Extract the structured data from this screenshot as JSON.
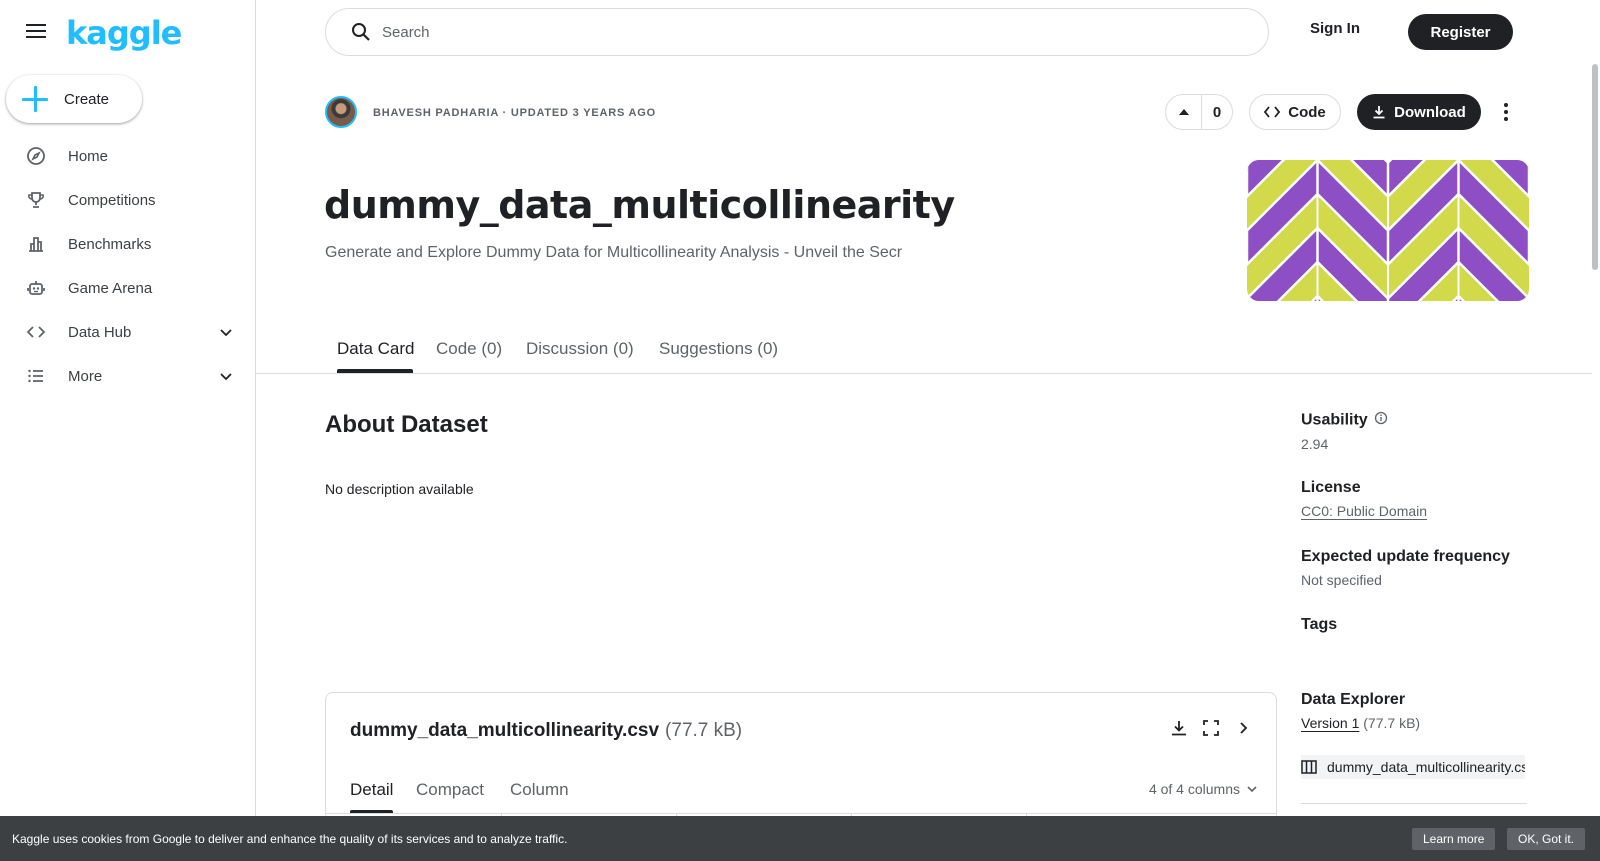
{
  "brand": {
    "logo_text": "kaggle",
    "accent": "#20beff"
  },
  "sidebar": {
    "create_label": "Create",
    "items": [
      {
        "label": "Home",
        "icon": "compass-icon"
      },
      {
        "label": "Competitions",
        "icon": "trophy-icon"
      },
      {
        "label": "Benchmarks",
        "icon": "bar-chart-icon"
      },
      {
        "label": "Game Arena",
        "icon": "robot-icon"
      },
      {
        "label": "Data Hub",
        "icon": "code-brackets-icon",
        "expandable": true
      },
      {
        "label": "More",
        "icon": "list-icon",
        "expandable": true
      }
    ]
  },
  "topbar": {
    "search_placeholder": "Search",
    "signin_label": "Sign In",
    "register_label": "Register"
  },
  "dataset": {
    "byline": "BHAVESH PADHARIA · UPDATED 3 YEARS AGO",
    "vote_count": "0",
    "code_label": "Code",
    "download_label": "Download",
    "title": "dummy_data_multicollinearity",
    "subtitle": "Generate and Explore Dummy Data for Multicollinearity Analysis - Unveil the Secr",
    "banner_colors": {
      "purple": "#8e4fc4",
      "yellow": "#d2d94a"
    }
  },
  "tabs": [
    {
      "label": "Data Card",
      "active": true
    },
    {
      "label": "Code (0)"
    },
    {
      "label": "Discussion (0)"
    },
    {
      "label": "Suggestions (0)"
    }
  ],
  "about": {
    "heading": "About Dataset",
    "description": "No description available"
  },
  "meta": {
    "usability_label": "Usability",
    "usability_value": "2.94",
    "license_label": "License",
    "license_value": "CC0: Public Domain",
    "frequency_label": "Expected update frequency",
    "frequency_value": "Not specified",
    "tags_label": "Tags",
    "explorer_label": "Data Explorer",
    "version_link": "Version 1",
    "version_size": "(77.7 kB)",
    "file_name": "dummy_data_multicollinearity.csv"
  },
  "file_card": {
    "name": "dummy_data_multicollinearity.csv",
    "size": "(77.7 kB)",
    "tabs": [
      "Detail",
      "Compact",
      "Column"
    ],
    "column_count": "4 of 4 columns"
  },
  "cookie": {
    "message": "Kaggle uses cookies from Google to deliver and enhance the quality of its services and to analyze traffic.",
    "learn_more": "Learn more",
    "ok": "OK, Got it."
  }
}
